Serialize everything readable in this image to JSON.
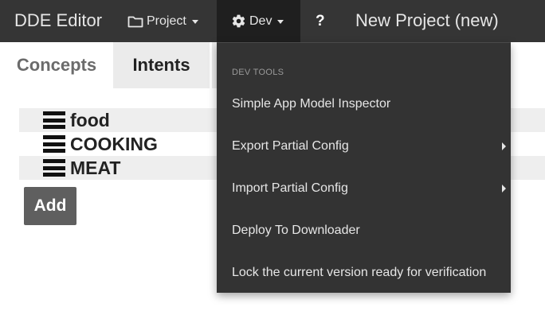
{
  "navbar": {
    "brand": "DDE Editor",
    "project_label": "Project",
    "dev_label": "Dev",
    "help_label": "?",
    "project_title": "New Project (new)",
    "icons": {
      "project": "folder-icon",
      "dev": "gear-icon"
    }
  },
  "tabs": [
    {
      "label": "Concepts",
      "active": true
    },
    {
      "label": "Intents",
      "active": false
    }
  ],
  "concepts": [
    {
      "label": "food"
    },
    {
      "label": "COOKING"
    },
    {
      "label": "MEAT"
    }
  ],
  "add_button_label": "Add",
  "dev_menu": {
    "header": "DEV TOOLS",
    "items": [
      {
        "label": "Simple App Model Inspector",
        "has_submenu": false
      },
      {
        "label": "Export Partial Config",
        "has_submenu": true
      },
      {
        "label": "Import Partial Config",
        "has_submenu": true
      },
      {
        "label": "Deploy To Downloader",
        "has_submenu": false
      },
      {
        "label": "Lock the current version ready for verification",
        "has_submenu": false
      }
    ]
  },
  "colors": {
    "navbar_bg": "#353535",
    "dropdown_bg": "#333333",
    "active_nav_bg": "#1f1f1f",
    "add_button_bg": "#5f5f5f"
  }
}
